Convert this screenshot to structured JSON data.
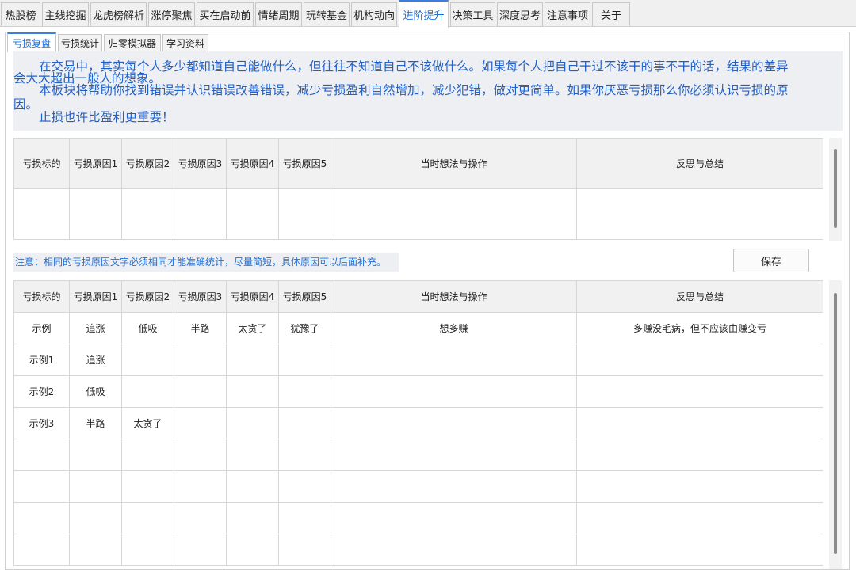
{
  "top_tabs": [
    {
      "label": "热股榜",
      "active": false
    },
    {
      "label": "主线挖掘",
      "active": false
    },
    {
      "label": "龙虎榜解析",
      "active": false
    },
    {
      "label": "涨停聚焦",
      "active": false
    },
    {
      "label": "买在启动前",
      "active": false
    },
    {
      "label": "情绪周期",
      "active": false
    },
    {
      "label": "玩转基金",
      "active": false
    },
    {
      "label": "机构动向",
      "active": false
    },
    {
      "label": "进阶提升",
      "active": true
    },
    {
      "label": "决策工具",
      "active": false
    },
    {
      "label": "深度思考",
      "active": false
    },
    {
      "label": "注意事项",
      "active": false
    },
    {
      "label": "关于",
      "active": false
    }
  ],
  "sub_tabs": [
    {
      "label": "亏损复盘",
      "active": true
    },
    {
      "label": "亏损统计",
      "active": false
    },
    {
      "label": "归零模拟器",
      "active": false
    },
    {
      "label": "学习资料",
      "active": false
    }
  ],
  "intro": {
    "line1": "在交易中，其实每个人多少都知道自己能做什么，但往往不知道自己不该做什么。如果每个人把自己干过不该干的事不干的话，结果的差异",
    "line2": "会大大超出一般人的想象。",
    "line3": "本板块将帮助你找到错误并认识错误改善错误，减少亏损盈利自然增加，减少犯错，做对更简单。如果你厌恶亏损那么你必须认识亏损的原",
    "line4": "因。",
    "line5": "止损也许比盈利更重要！"
  },
  "columns": [
    "亏损标的",
    "亏损原因1",
    "亏损原因2",
    "亏损原因3",
    "亏损原因4",
    "亏损原因5",
    "当时想法与操作",
    "反思与总结"
  ],
  "entry_row": [
    "",
    "",
    "",
    "",
    "",
    "",
    "",
    ""
  ],
  "note": "注意：相同的亏损原因文字必须相同才能准确统计，尽量简短，具体原因可以后面补充。",
  "save_label": "保存",
  "examples": [
    [
      "示例",
      "追涨",
      "低吸",
      "半路",
      "太贪了",
      "犹豫了",
      "想多赚",
      "多赚没毛病，但不应该由赚变亏"
    ],
    [
      "示例1",
      "追涨",
      "",
      "",
      "",
      "",
      "",
      ""
    ],
    [
      "示例2",
      "低吸",
      "",
      "",
      "",
      "",
      "",
      ""
    ],
    [
      "示例3",
      "半路",
      "太贪了",
      "",
      "",
      "",
      "",
      ""
    ],
    [
      "",
      "",
      "",
      "",
      "",
      "",
      "",
      ""
    ],
    [
      "",
      "",
      "",
      "",
      "",
      "",
      "",
      ""
    ],
    [
      "",
      "",
      "",
      "",
      "",
      "",
      "",
      ""
    ],
    [
      "",
      "",
      "",
      "",
      "",
      "",
      "",
      ""
    ]
  ]
}
